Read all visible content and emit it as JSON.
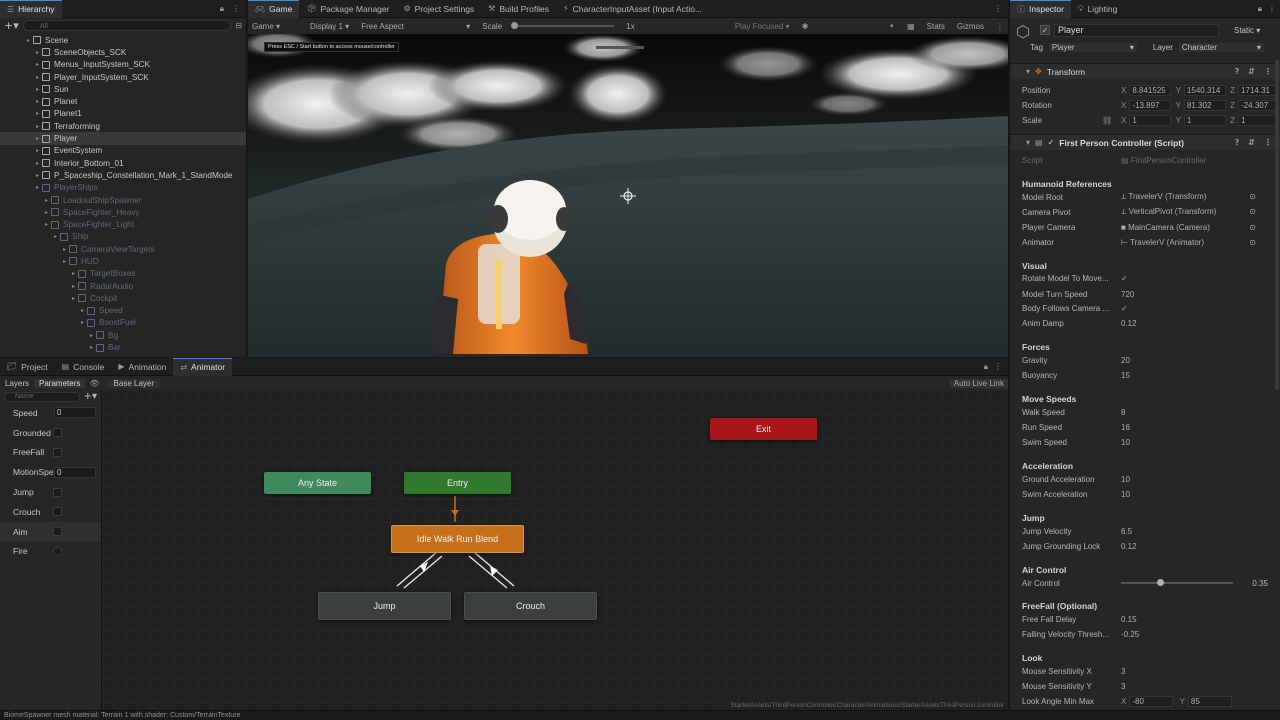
{
  "hierarchy": {
    "tab_label": "Hierarchy",
    "search_placeholder": "All",
    "items": [
      {
        "label": "Scene",
        "depth": 0,
        "style": "normal"
      },
      {
        "label": "SceneObjects_SCK",
        "depth": 1,
        "style": "normal"
      },
      {
        "label": "Menus_InputSystem_SCK",
        "depth": 1,
        "style": "normal"
      },
      {
        "label": "Player_InputSystem_SCK",
        "depth": 1,
        "style": "normal"
      },
      {
        "label": "Sun",
        "depth": 1,
        "style": "normal"
      },
      {
        "label": "Planet",
        "depth": 1,
        "style": "normal"
      },
      {
        "label": "Planet1",
        "depth": 1,
        "style": "normal"
      },
      {
        "label": "Terraforming",
        "depth": 1,
        "style": "normal"
      },
      {
        "label": "Player",
        "depth": 1,
        "style": "selected"
      },
      {
        "label": "EventSystem",
        "depth": 1,
        "style": "normal"
      },
      {
        "label": "Interior_Bottom_01",
        "depth": 1,
        "style": "normal"
      },
      {
        "label": "P_Spaceship_Constellation_Mark_1_StandMode",
        "depth": 1,
        "style": "normal"
      },
      {
        "label": "PlayerShips",
        "depth": 1,
        "style": "dim"
      },
      {
        "label": "LoadoutShipSpawner",
        "depth": 2,
        "style": "dim"
      },
      {
        "label": "SpaceFighter_Heavy",
        "depth": 2,
        "style": "dim"
      },
      {
        "label": "SpaceFighter_Light",
        "depth": 2,
        "style": "dim"
      },
      {
        "label": "Ship",
        "depth": 3,
        "style": "dim"
      },
      {
        "label": "CameraViewTargets",
        "depth": 4,
        "style": "dim"
      },
      {
        "label": "HUD",
        "depth": 4,
        "style": "dim"
      },
      {
        "label": "TargetBoxes",
        "depth": 5,
        "style": "dim"
      },
      {
        "label": "RadarAudio",
        "depth": 5,
        "style": "dim"
      },
      {
        "label": "Cockpit",
        "depth": 5,
        "style": "dim"
      },
      {
        "label": "Speed",
        "depth": 6,
        "style": "dim"
      },
      {
        "label": "BoostFuel",
        "depth": 6,
        "style": "dim"
      },
      {
        "label": "Bg",
        "depth": 7,
        "style": "dim"
      },
      {
        "label": "Bar",
        "depth": 7,
        "style": "dim"
      }
    ]
  },
  "top_tabs": [
    {
      "label": "Game",
      "active": true
    },
    {
      "label": "Package Manager",
      "active": false
    },
    {
      "label": "Project Settings",
      "active": false
    },
    {
      "label": "Build Profiles",
      "active": false
    },
    {
      "label": "CharacterInputAsset (Input Actio...",
      "active": false
    }
  ],
  "game_toolbar": {
    "mode": "Game",
    "display": "Display 1",
    "aspect": "Free Aspect",
    "scale_label": "Scale",
    "scale_value": "1x",
    "play_focused": "Play Focused",
    "stats": "Stats",
    "gizmos": "Gizmos"
  },
  "viewport_hint": "Press ESC / Start button to access mouse/controller",
  "bottom_tabs": [
    {
      "label": "Project",
      "active": false
    },
    {
      "label": "Console",
      "active": false
    },
    {
      "label": "Animation",
      "active": false
    },
    {
      "label": "Animator",
      "active": true
    }
  ],
  "animator": {
    "layers_tab": "Layers",
    "parameters_tab": "Parameters",
    "breadcrumb": "Base Layer",
    "auto_live_link": "Auto Live Link",
    "search_placeholder": "Name",
    "parameters": [
      {
        "name": "Speed",
        "kind": "float",
        "value": "0"
      },
      {
        "name": "Grounded",
        "kind": "bool",
        "value": ""
      },
      {
        "name": "FreeFall",
        "kind": "bool",
        "value": ""
      },
      {
        "name": "MotionSpeed",
        "kind": "float",
        "value": "0"
      },
      {
        "name": "Jump",
        "kind": "bool",
        "value": ""
      },
      {
        "name": "Crouch",
        "kind": "bool",
        "value": ""
      },
      {
        "name": "Aim",
        "kind": "bool",
        "value": ""
      },
      {
        "name": "Fire",
        "kind": "trigger",
        "value": ""
      }
    ],
    "nodes": {
      "any_state": "Any State",
      "entry": "Entry",
      "exit": "Exit",
      "idle_walk_run": "Idle Walk Run Blend",
      "jump": "Jump",
      "crouch": "Crouch"
    },
    "path": "StarterAssets/ThirdPersonController/Character/Animations/StarterAssetsThirdPerson.controller",
    "colors": {
      "any_state": "#3f8a5f",
      "entry": "#2f7a2f",
      "exit": "#a8161c",
      "default_state": "#c7701a",
      "state": "#3b3f3f"
    }
  },
  "inspector": {
    "tabs": [
      {
        "label": "Inspector",
        "active": true
      },
      {
        "label": "Lighting",
        "active": false
      }
    ],
    "object_name": "Player",
    "static_label": "Static",
    "tag_label": "Tag",
    "tag_value": "Player",
    "layer_label": "Layer",
    "layer_value": "Character",
    "transform": {
      "title": "Transform",
      "position": {
        "label": "Position",
        "x": "8.841525",
        "y": "1540.314",
        "z": "1714.31"
      },
      "rotation": {
        "label": "Rotation",
        "x": "-13.897",
        "y": "81.302",
        "z": "-24.307"
      },
      "scale": {
        "label": "Scale",
        "x": "1",
        "y": "1",
        "z": "1"
      }
    },
    "controller": {
      "title": "First Person Controller (Script)",
      "script_label": "Script",
      "script_value": "FirstPersonController",
      "humanoid_header": "Humanoid References",
      "model_root": {
        "label": "Model Root",
        "value": "TravelerV (Transform)"
      },
      "camera_pivot": {
        "label": "Camera Pivot",
        "value": "VerticalPivot (Transform)"
      },
      "player_camera": {
        "label": "Player Camera",
        "value": "MainCamera (Camera)"
      },
      "animator": {
        "label": "Animator",
        "value": "TravelerV (Animator)"
      },
      "visual_header": "Visual",
      "rotate_model": {
        "label": "Rotate Model To Move...",
        "value": "✓"
      },
      "model_turn_speed": {
        "label": "Model Turn Speed",
        "value": "720"
      },
      "body_follows": {
        "label": "Body Follows Camera ...",
        "value": "✓"
      },
      "anim_damp": {
        "label": "Anim Damp",
        "value": "0.12"
      },
      "forces_header": "Forces",
      "gravity": {
        "label": "Gravity",
        "value": "20"
      },
      "buoyancy": {
        "label": "Buoyancy",
        "value": "15"
      },
      "move_header": "Move Speeds",
      "walk_speed": {
        "label": "Walk Speed",
        "value": "8"
      },
      "run_speed": {
        "label": "Run Speed",
        "value": "16"
      },
      "swim_speed": {
        "label": "Swim Speed",
        "value": "10"
      },
      "accel_header": "Acceleration",
      "ground_accel": {
        "label": "Ground Acceleration",
        "value": "10"
      },
      "swim_accel": {
        "label": "Swim Acceleration",
        "value": "10"
      },
      "jump_header": "Jump",
      "jump_velocity": {
        "label": "Jump Velocity",
        "value": "6.5"
      },
      "jump_lock": {
        "label": "Jump Grounding Lock",
        "value": "0.12"
      },
      "air_header": "Air Control",
      "air_control": {
        "label": "Air Control",
        "value": "0.35",
        "fraction": 0.35
      },
      "freefall_header": "FreeFall (Optional)",
      "freefall_delay": {
        "label": "Free Fall Delay",
        "value": "0.15"
      },
      "falling_threshold": {
        "label": "Falling Velocity Thresh...",
        "value": "-0.25"
      },
      "look_header": "Look",
      "mouse_x": {
        "label": "Mouse Sensitivity X",
        "value": "3"
      },
      "mouse_y": {
        "label": "Mouse Sensitivity Y",
        "value": "3"
      },
      "look_angle": {
        "label": "Look Angle Min Max",
        "x_label": "X",
        "x": "-80",
        "y_label": "Y",
        "y": "85"
      }
    }
  },
  "status_bar": "BiomeSpawner mesh material: Terrain 1 with shader: Custom/TerrainTexture"
}
